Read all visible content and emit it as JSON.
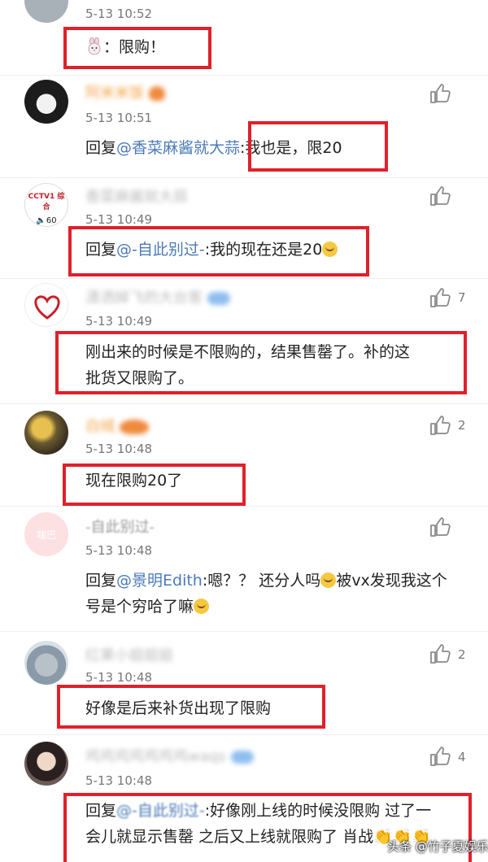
{
  "comments": [
    {
      "time": "5-13 10:52",
      "content": "：限购！"
    },
    {
      "name": "阿米米饭",
      "time": "5-13 10:51",
      "reply_prefix": "回复",
      "mention": "@香菜麻酱就大蒜",
      "content": ":我也是，限20"
    },
    {
      "name": "香菜麻酱就大蒜",
      "avatar_text": "CCTV1 综合",
      "avatar_badge": "60",
      "time": "5-13 10:49",
      "reply_prefix": "回复",
      "mention": "@-自此别过-",
      "content": ":我的现在还是20"
    },
    {
      "name": "潇洒掉飞的大台客",
      "time": "5-13 10:49",
      "like_count": "7",
      "content": "刚出来的时候是不限购的，结果售罄了。补的这批货又限购了。"
    },
    {
      "name": "白绒",
      "time": "5-13 10:48",
      "like_count": "2",
      "content": "现在限购20了"
    },
    {
      "name": "-自此别过-",
      "avatar_text": "嗤巴",
      "time": "5-13 10:48",
      "reply_prefix": "回复",
      "mention": "@景明Edith",
      "content_line1": ":嗯？？ 还分人吗",
      "content_line1b": "被vx发现我这个",
      "content_line2": "号是个穷哈了嘛"
    },
    {
      "name": "红果小姐姐姐",
      "time": "5-13 10:48",
      "like_count": "2",
      "content": "好像是后来补货出现了限购"
    },
    {
      "name": "鸡鸡鸡鸡鸡鸡鸡waqs",
      "time": "5-13 10:48",
      "like_count": "4",
      "reply_prefix": "回复",
      "mention": "@-自此别过-",
      "content_line1": ":好像刚上线的时候没限购 过了一",
      "content_line2": "会儿就显示售罄 之后又上线就限购了 肖战"
    }
  ],
  "watermark": "头条 @竹子夏娱乐",
  "icons": {
    "like": "thumbs-up-icon",
    "emoji": "laughing-emoji-icon",
    "rabbit": "rabbit-emoji-icon"
  },
  "colors": {
    "highlight_box": "#e0202a",
    "mention": "#4b7ab8"
  }
}
